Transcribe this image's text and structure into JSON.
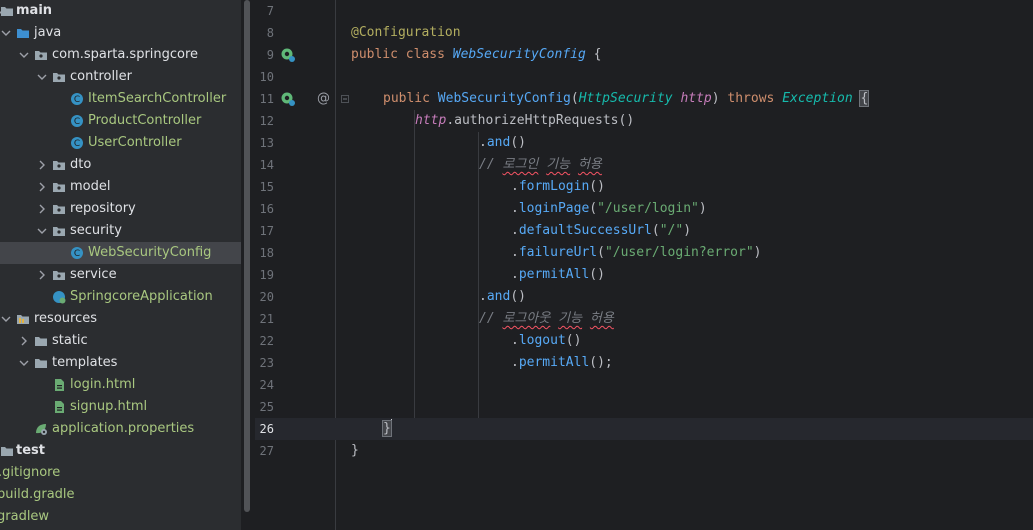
{
  "project_tree": {
    "items": [
      {
        "label": "main",
        "kind": "folder",
        "expanded": true,
        "bold": true
      },
      {
        "label": "java",
        "kind": "source-folder",
        "expanded": true
      },
      {
        "label": "com.sparta.springcore",
        "kind": "package",
        "expanded": true
      },
      {
        "label": "controller",
        "kind": "package",
        "expanded": true
      },
      {
        "label": "ItemSearchController",
        "kind": "class"
      },
      {
        "label": "ProductController",
        "kind": "class"
      },
      {
        "label": "UserController",
        "kind": "class"
      },
      {
        "label": "dto",
        "kind": "package",
        "expanded": false
      },
      {
        "label": "model",
        "kind": "package",
        "expanded": false
      },
      {
        "label": "repository",
        "kind": "package",
        "expanded": false
      },
      {
        "label": "security",
        "kind": "package",
        "expanded": true
      },
      {
        "label": "WebSecurityConfig",
        "kind": "class",
        "selected": true
      },
      {
        "label": "service",
        "kind": "package",
        "expanded": false
      },
      {
        "label": "SpringcoreApplication",
        "kind": "spring-class"
      },
      {
        "label": "resources",
        "kind": "resources-folder",
        "expanded": true
      },
      {
        "label": "static",
        "kind": "folder",
        "expanded": false
      },
      {
        "label": "templates",
        "kind": "folder",
        "expanded": true
      },
      {
        "label": "login.html",
        "kind": "html-file"
      },
      {
        "label": "signup.html",
        "kind": "html-file"
      },
      {
        "label": "application.properties",
        "kind": "properties-file"
      },
      {
        "label": "test",
        "kind": "folder",
        "expanded": false,
        "bold": true
      },
      {
        "label": ".gitignore",
        "kind": "file"
      },
      {
        "label": "build.gradle",
        "kind": "file"
      },
      {
        "label": "gradlew",
        "kind": "file"
      }
    ]
  },
  "editor": {
    "current_line": "26",
    "lines": [
      {
        "num": "7"
      },
      {
        "num": "8",
        "annot": "@Configuration"
      },
      {
        "num": "9",
        "kw": "public class ",
        "cls": "WebSecurityConfig",
        "rest": " {"
      },
      {
        "num": "10"
      },
      {
        "num": "11",
        "kw": "public ",
        "ctor": "WebSecurityConfig",
        "p1": "(",
        "type": "HttpSecurity",
        "sp": " ",
        "param": "http",
        "p2": ") ",
        "kw2": "throws ",
        "type2": "Exception",
        "sp2": " ",
        "brace": "{"
      },
      {
        "num": "12",
        "field": "http",
        "dot": ".",
        "meth": "authorizeHttpRequests",
        "rest": "()"
      },
      {
        "num": "13",
        "dot": ".",
        "meth": "and",
        "rest": "()"
      },
      {
        "num": "14",
        "cmt": "// ",
        "k1": "로그인",
        "s1": " ",
        "k2": "기능",
        "s2": " ",
        "k3": "허용"
      },
      {
        "num": "15",
        "dot": ".",
        "meth": "formLogin",
        "rest": "()"
      },
      {
        "num": "16",
        "dot": ".",
        "meth": "loginPage",
        "p1": "(",
        "str": "\"/user/login\"",
        "rest": ")"
      },
      {
        "num": "17",
        "dot": ".",
        "meth": "defaultSuccessUrl",
        "p1": "(",
        "str": "\"/\"",
        "rest": ")"
      },
      {
        "num": "18",
        "dot": ".",
        "meth": "failureUrl",
        "p1": "(",
        "str": "\"/user/login?error\"",
        "rest": ")"
      },
      {
        "num": "19",
        "dot": ".",
        "meth": "permitAll",
        "rest": "()"
      },
      {
        "num": "20",
        "dot": ".",
        "meth": "and",
        "rest": "()"
      },
      {
        "num": "21",
        "cmt": "// ",
        "k1": "로그아웃",
        "s1": " ",
        "k2": "기능",
        "s2": " ",
        "k3": "허용"
      },
      {
        "num": "22",
        "dot": ".",
        "meth": "logout",
        "rest": "()"
      },
      {
        "num": "23",
        "dot": ".",
        "meth": "permitAll",
        "rest": "();"
      },
      {
        "num": "24"
      },
      {
        "num": "25"
      },
      {
        "num": "26",
        "brace": "}"
      },
      {
        "num": "27",
        "rest": "}"
      }
    ]
  },
  "gutter": {
    "override_marker": "@"
  },
  "colors": {
    "tree_bg": "#2b2d30",
    "editor_bg": "#1e1f22",
    "selection": "#43454a",
    "annotation": "#b3ae60",
    "keyword": "#cf8e6d",
    "class_name": "#56a8f5",
    "string": "#6aab73",
    "comment": "#7a7e85",
    "field": "#c77dbb"
  }
}
